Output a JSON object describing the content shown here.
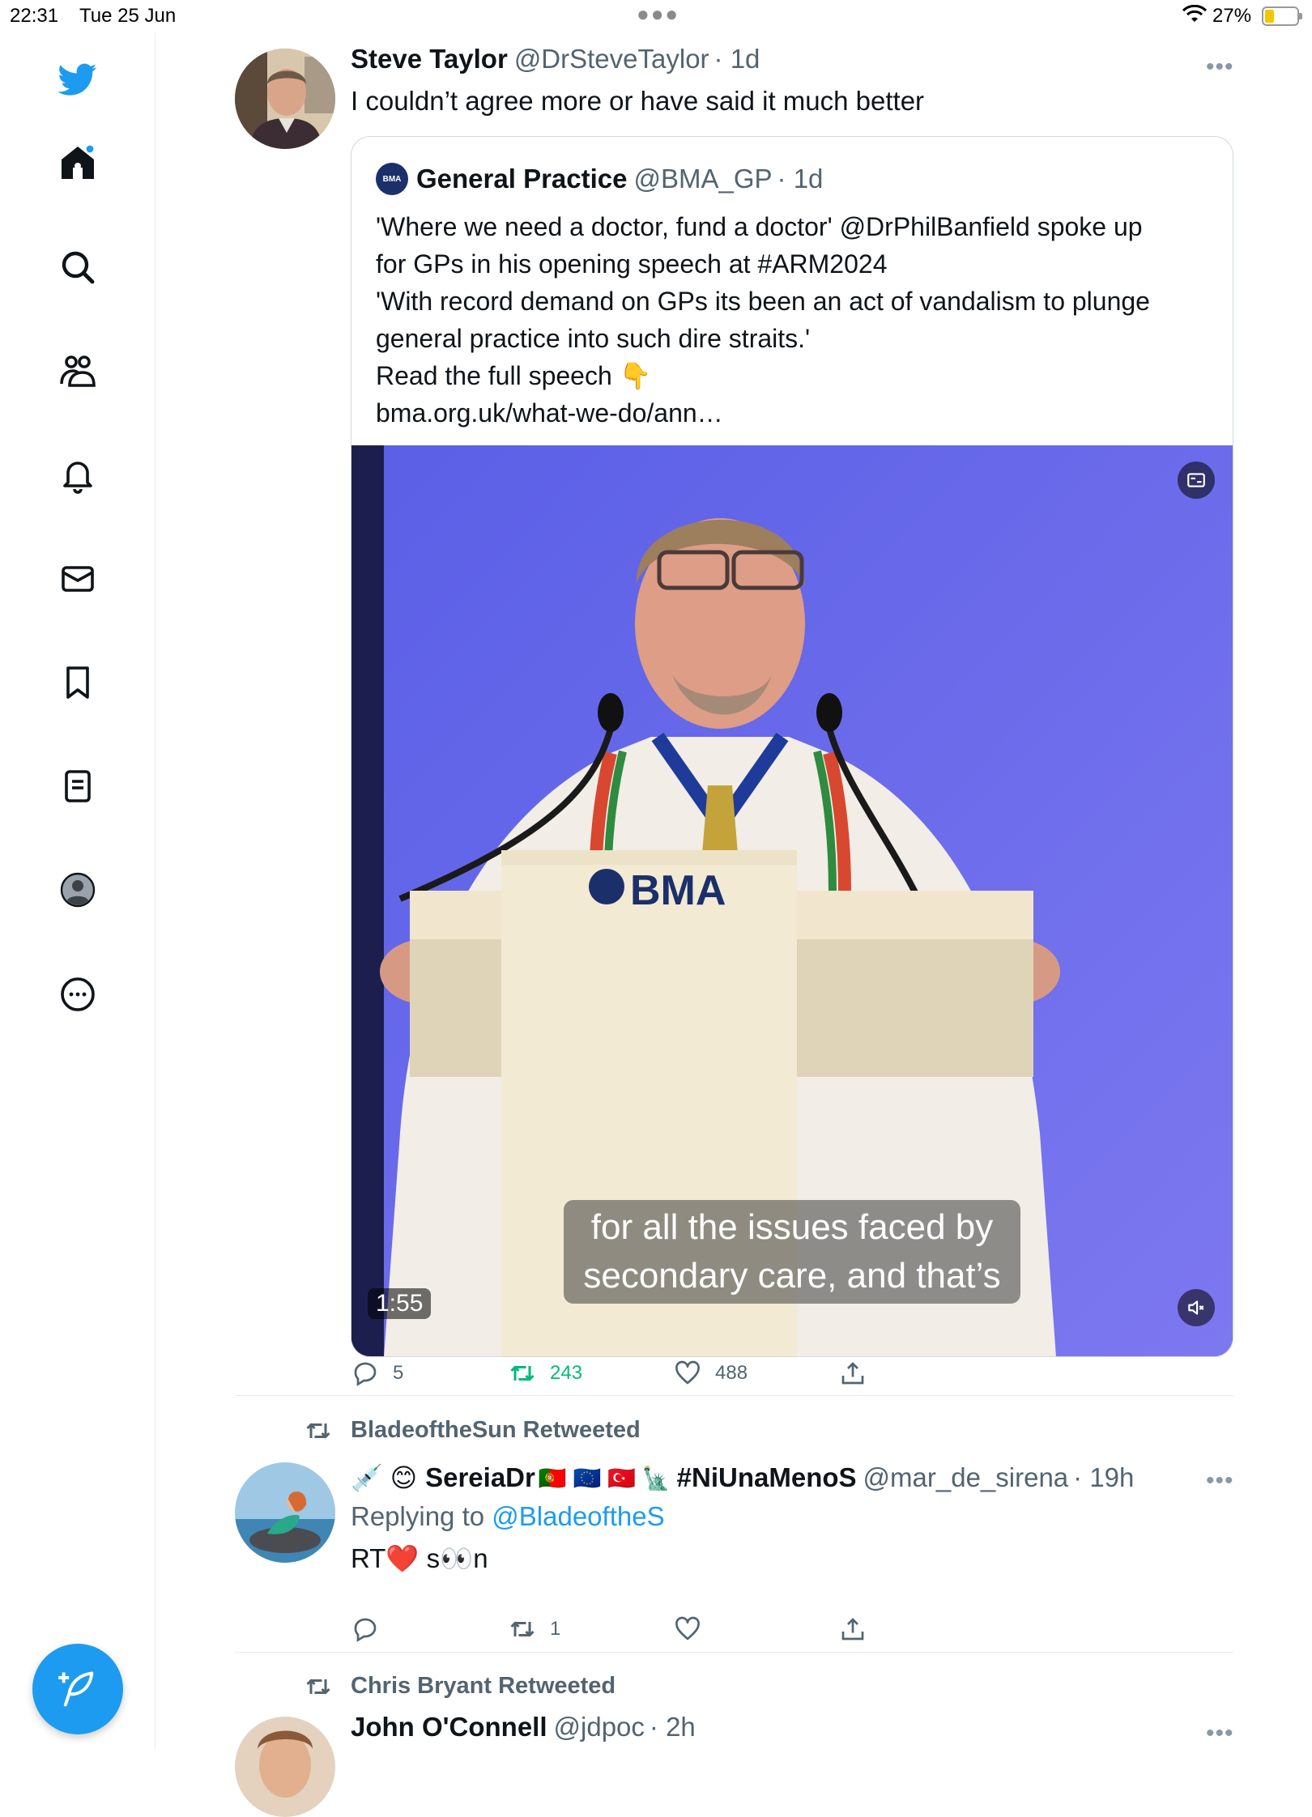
{
  "status_bar": {
    "time": "22:31",
    "date": "Tue 25 Jun",
    "battery": "27%",
    "battery_level": 0.27
  },
  "sidebar": {
    "items": [
      "twitter-logo",
      "home",
      "search",
      "communities",
      "notifications",
      "messages",
      "bookmarks",
      "lists",
      "profile",
      "more"
    ],
    "home_has_notification_dot": true
  },
  "tweet1": {
    "name": "Steve Taylor",
    "handle": "@DrSteveTaylor",
    "time": "· 1d",
    "text": "I couldn’t agree more or have said it much better",
    "quote": {
      "badge": "BMA",
      "name": "General Practice",
      "handle": "@BMA_GP",
      "time": "· 1d",
      "lines": [
        "'Where we need a doctor, fund a doctor' @DrPhilBanfield spoke up",
        "for GPs in his opening speech at #ARM2024",
        "'With record demand on GPs its been an act of vandalism to plunge",
        "general practice into such dire straits.'",
        "Read the full speech 👇",
        "bma.org.uk/what-we-do/ann…"
      ],
      "video": {
        "podium_logo": "BMA",
        "caption_line1": "for all the issues faced by",
        "caption_line2": "secondary care, and that’s",
        "duration": "1:55"
      }
    },
    "replies": "5",
    "retweets": "243",
    "likes": "488"
  },
  "tweet2": {
    "retweeted_by": "BladeoftheSun Retweeted",
    "name_prefix": "💉 😊",
    "name": "SereiaDr",
    "flags": "🇵🇹 🇪🇺 🇹🇷 🗽",
    "name_suffix": "#NiUnaMenoS",
    "handle": "@mar_de_sirena",
    "time": "· 19h",
    "replying_label": "Replying to ",
    "replying_to": "@BladeoftheS",
    "text": "RT❤️  s👀n",
    "replies": "",
    "retweets": "1",
    "likes": ""
  },
  "tweet3": {
    "retweeted_by": "Chris Bryant Retweeted",
    "name": "John O'Connell",
    "handle": "@jdpoc",
    "time": "· 2h"
  },
  "colors": {
    "brand": "#1d9bf0",
    "retweet_active": "#00ba7c",
    "muted": "#536471",
    "video_bg": "#6e6ce8"
  }
}
